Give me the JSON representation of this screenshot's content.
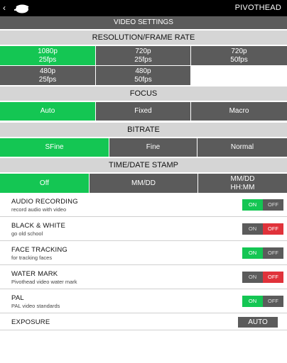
{
  "app": {
    "brand": "PIVOTHEAD"
  },
  "header": {
    "back_glyph": "‹",
    "logo_icon": "pivothead-logo"
  },
  "title": "VIDEO SETTINGS",
  "resolution": {
    "label": "RESOLUTION/FRAME RATE",
    "options": [
      {
        "line1": "1080p",
        "line2": "25fps",
        "selected": true
      },
      {
        "line1": "720p",
        "line2": "25fps",
        "selected": false
      },
      {
        "line1": "720p",
        "line2": "50fps",
        "selected": false
      },
      {
        "line1": "480p",
        "line2": "25fps",
        "selected": false
      },
      {
        "line1": "480p",
        "line2": "50fps",
        "selected": false
      }
    ]
  },
  "focus": {
    "label": "FOCUS",
    "options": [
      {
        "label": "Auto",
        "selected": true
      },
      {
        "label": "Fixed",
        "selected": false
      },
      {
        "label": "Macro",
        "selected": false
      }
    ]
  },
  "bitrate": {
    "label": "BITRATE",
    "options": [
      {
        "label": "SFine",
        "selected": true
      },
      {
        "label": "Fine",
        "selected": false
      },
      {
        "label": "Normal",
        "selected": false
      }
    ]
  },
  "timestamp": {
    "label": "TIME/DATE STAMP",
    "options": [
      {
        "line1": "Off",
        "line2": "",
        "selected": true
      },
      {
        "line1": "MM/DD",
        "line2": "",
        "selected": false
      },
      {
        "line1": "MM/DD",
        "line2": "HH:MM",
        "selected": false
      }
    ]
  },
  "toggle_labels": {
    "on": "ON",
    "off": "OFF"
  },
  "settings": [
    {
      "name": "AUDIO RECORDING",
      "sub": "record audio with video",
      "state": "on"
    },
    {
      "name": "BLACK & WHITE",
      "sub": "go old school",
      "state": "off"
    },
    {
      "name": "FACE TRACKING",
      "sub": "for tracking faces",
      "state": "on"
    },
    {
      "name": "WATER MARK",
      "sub": "Pivothead video water mark",
      "state": "off"
    },
    {
      "name": "PAL",
      "sub": "PAL video standards",
      "state": "on"
    }
  ],
  "exposure": {
    "name": "EXPOSURE",
    "value": "AUTO"
  },
  "colors": {
    "selected": "#14c653",
    "unselected": "#5b5b5b",
    "off_active": "#e0323a",
    "section_bg": "#d5d5d5"
  }
}
